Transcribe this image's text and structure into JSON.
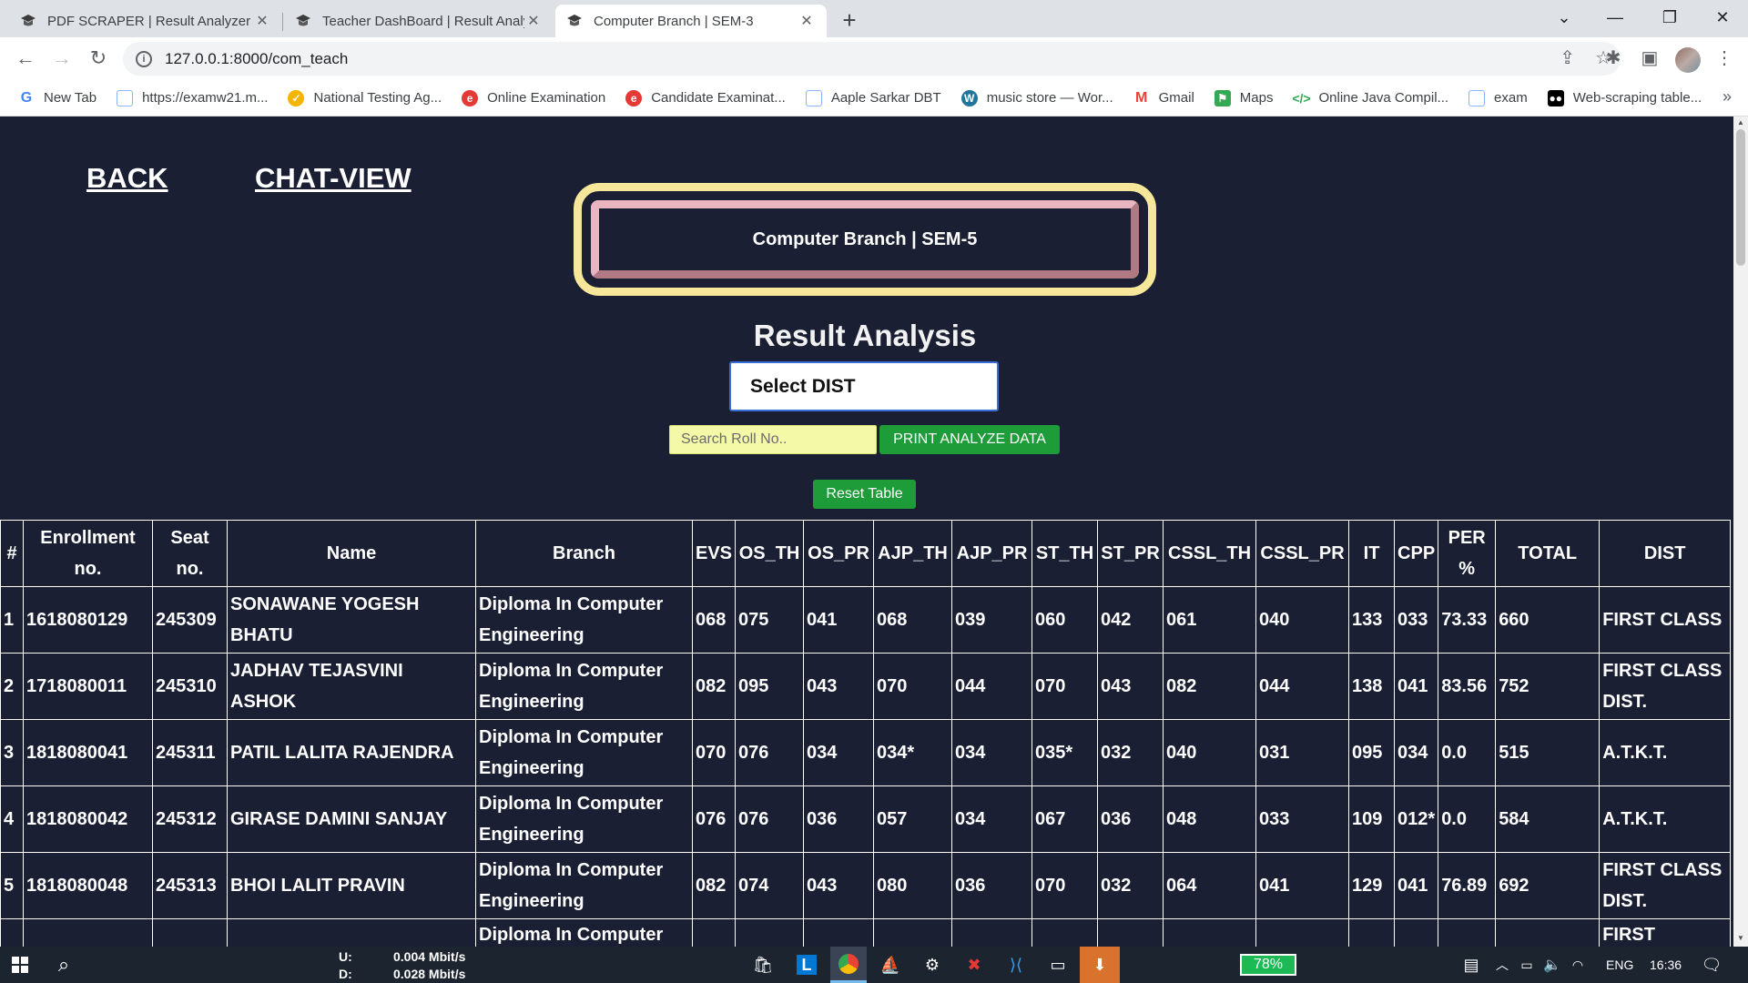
{
  "browser": {
    "tabs": [
      {
        "title": "PDF SCRAPER | Result Analyzer S",
        "active": false
      },
      {
        "title": "Teacher DashBoard | Result Analy",
        "active": false
      },
      {
        "title": "Computer Branch | SEM-3",
        "active": true
      }
    ],
    "url": "127.0.0.1:8000/com_teach",
    "bookmarks": [
      {
        "label": "New Tab",
        "icon": "google-icon",
        "color": "#4285f4"
      },
      {
        "label": "https://examw21.m...",
        "icon": "page-icon",
        "color": "#8ab4f8"
      },
      {
        "label": "National Testing Ag...",
        "icon": "nta-icon",
        "color": "#f4b400"
      },
      {
        "label": "Online Examination",
        "icon": "exam-icon",
        "color": "#e53935"
      },
      {
        "label": "Candidate Examinat...",
        "icon": "exam-icon",
        "color": "#e53935"
      },
      {
        "label": "Aaple Sarkar DBT",
        "icon": "page-icon",
        "color": "#8ab4f8"
      },
      {
        "label": "music store — Wor...",
        "icon": "wordpress-icon",
        "color": "#21759b"
      },
      {
        "label": "Gmail",
        "icon": "gmail-icon",
        "color": "#ea4335"
      },
      {
        "label": "Maps",
        "icon": "maps-icon",
        "color": "#34a853"
      },
      {
        "label": "Online Java Compil...",
        "icon": "code-icon",
        "color": "#34a853"
      },
      {
        "label": "exam",
        "icon": "page-icon",
        "color": "#8ab4f8"
      },
      {
        "label": "Web-scraping table...",
        "icon": "medium-icon",
        "color": "#000000"
      }
    ]
  },
  "page": {
    "back_label": "BACK",
    "chat_view_label": "CHAT-VIEW",
    "branch_title": "Computer Branch | SEM-5",
    "heading": "Result Analysis",
    "select_dist_label": "Select DIST",
    "search_placeholder": "Search Roll No..",
    "print_button": "PRINT ANALYZE DATA",
    "reset_button": "Reset Table"
  },
  "table": {
    "headers": [
      "#",
      "Enrollment no.",
      "Seat no.",
      "Name",
      "Branch",
      "EVS",
      "OS_TH",
      "OS_PR",
      "AJP_TH",
      "AJP_PR",
      "ST_TH",
      "ST_PR",
      "CSSL_TH",
      "CSSL_PR",
      "IT",
      "CPP",
      "PER %",
      "TOTAL",
      "DIST"
    ],
    "rows": [
      [
        "1",
        "1618080129",
        "245309",
        "SONAWANE YOGESH BHATU",
        "Diploma In Computer Engineering",
        "068",
        "075",
        "041",
        "068",
        "039",
        "060",
        "042",
        "061",
        "040",
        "133",
        "033",
        "73.33",
        "660",
        "FIRST CLASS"
      ],
      [
        "2",
        "1718080011",
        "245310",
        "JADHAV TEJASVINI ASHOK",
        "Diploma In Computer Engineering",
        "082",
        "095",
        "043",
        "070",
        "044",
        "070",
        "043",
        "082",
        "044",
        "138",
        "041",
        "83.56",
        "752",
        "FIRST CLASS DIST."
      ],
      [
        "3",
        "1818080041",
        "245311",
        "PATIL LALITA RAJENDRA",
        "Diploma In Computer Engineering",
        "070",
        "076",
        "034",
        "034*",
        "034",
        "035*",
        "032",
        "040",
        "031",
        "095",
        "034",
        "0.0",
        "515",
        "A.T.K.T."
      ],
      [
        "4",
        "1818080042",
        "245312",
        "GIRASE DAMINI SANJAY",
        "Diploma In Computer Engineering",
        "076",
        "076",
        "036",
        "057",
        "034",
        "067",
        "036",
        "048",
        "033",
        "109",
        "012*",
        "0.0",
        "584",
        "A.T.K.T."
      ],
      [
        "5",
        "1818080048",
        "245313",
        "BHOI LALIT PRAVIN",
        "Diploma In Computer Engineering",
        "082",
        "074",
        "043",
        "080",
        "036",
        "070",
        "032",
        "064",
        "041",
        "129",
        "041",
        "76.89",
        "692",
        "FIRST CLASS DIST."
      ],
      [
        "",
        "",
        "",
        "",
        "Diploma In Computer",
        "",
        "",
        "",
        "",
        "",
        "",
        "",
        "",
        "",
        "",
        "",
        "",
        "",
        "FIRST"
      ]
    ]
  },
  "taskbar": {
    "upload_label": "U:",
    "upload_speed": "0.004 Mbit/s",
    "download_label": "D:",
    "download_speed": "0.028 Mbit/s",
    "battery": "78%",
    "language": "ENG",
    "time": "16:36"
  }
}
